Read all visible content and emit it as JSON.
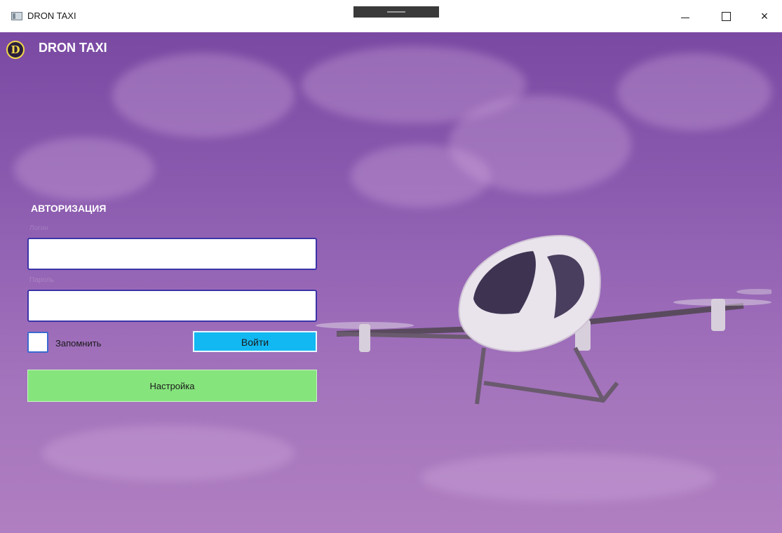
{
  "window": {
    "title": "DRON TAXI",
    "controls": {
      "minimize": "minimize",
      "maximize": "maximize",
      "close": "×"
    }
  },
  "header": {
    "logo_letter": "D",
    "app_name": "DRON TAXI"
  },
  "auth": {
    "title": "АВТОРИЗАЦИЯ",
    "login_label": "Логин",
    "login_value": "",
    "password_label": "Пароль",
    "password_value": "",
    "remember_label": "Запомнить",
    "login_button": "Войти",
    "settings_button": "Настройка"
  },
  "colors": {
    "background_tint": "#8a5aaf",
    "login_button": "#12b8f2",
    "settings_button": "#86e47d",
    "input_border": "#3b33a8"
  },
  "icons": {
    "app": "app-window-icon",
    "logo": "dron-taxi-logo-icon"
  }
}
